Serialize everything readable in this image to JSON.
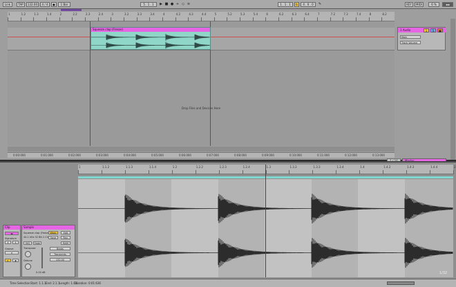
{
  "topbar": {
    "link_label": "Link",
    "tap_label": "TAP",
    "tempo": "132.00",
    "time_sig": "4 / 4",
    "metro_label": "1 Bar",
    "pos": "5 . 1 . 1",
    "loop_start": "1 . 1 . 1",
    "loop_len": "4 . 0 . 0",
    "key_label": "KEY",
    "midi_label": "MIDI",
    "cpu": "6 %"
  },
  "arrangement": {
    "ruler_labels": [
      "1",
      "1.2",
      "1.3",
      "1.4",
      "2",
      "2.2",
      "2.3",
      "2.4",
      "3",
      "3.2",
      "3.3",
      "3.4",
      "4",
      "4.2",
      "4.3",
      "4.4",
      "5",
      "5.2",
      "5.3",
      "5.4",
      "6",
      "6.2",
      "6.3",
      "6.4",
      "7",
      "7.2",
      "7.3",
      "7.4",
      "8",
      "8.2"
    ],
    "clip_name": "Squeeze clap (Freeze)",
    "drop_text": "Drop Files and Devices Here",
    "time_labels": [
      "0:00:000",
      "0:01:000",
      "0:02:000",
      "0:03:000",
      "0:04:000",
      "0:05:000",
      "0:06:000",
      "0:07:000",
      "0:08:000",
      "0:09:000",
      "0:10:000",
      "0:11:000",
      "0:12:000",
      "0:13:000"
    ],
    "track": {
      "name": "1 Audio",
      "num": "1",
      "s": "S",
      "input": "Main",
      "monitor": "Track Volume"
    },
    "master_label": "Master",
    "page": "1 / 16"
  },
  "detail": {
    "clip_label": "Clip",
    "sample_label": "Sample",
    "sample_name": "Squeeze clap (Freeze)",
    "sample_info": "44.1 kHz 32 Bit 2 Ch",
    "warp_label": "Warp",
    "edit_label": "Edit",
    "save_label": "Save",
    "rev_label": "Rev.",
    "hiq_label": "HiQ",
    "fade_label": "Fade",
    "ram_label": "RAM",
    "beats_label": "Beats",
    "transient_label": "Transients",
    "seg_bpm": "132.00",
    "transpose_label": "Transpose",
    "detune_label": "Detune",
    "volume_label": "0.00 dB",
    "clip_signature": "Signature",
    "clip_groove": "Groove",
    "ruler_labels": [
      "1",
      "1.1.2",
      "1.1.3",
      "1.1.4",
      "1.2",
      "1.2.2",
      "1.2.3",
      "1.2.4",
      "1.3",
      "1.3.2",
      "1.3.3",
      "1.3.4",
      "1.4",
      "1.4.2",
      "1.4.3",
      "1.4.4",
      "2"
    ],
    "zoom_label": "1/32"
  },
  "status": {
    "selection": "Time Selection",
    "start": "Start: 1.1.1",
    "end": "End: 2.1.1",
    "length": "Length: 1.0.0",
    "duration": "Duration: 0:01:636"
  }
}
